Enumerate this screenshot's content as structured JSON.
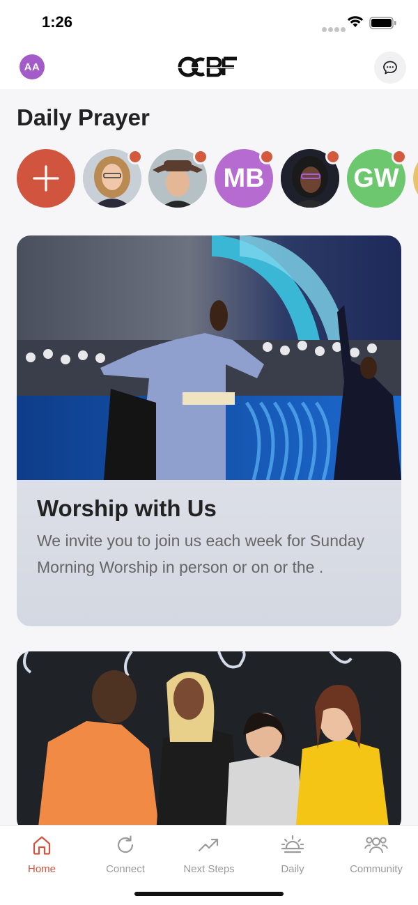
{
  "status_bar": {
    "time": "1:26"
  },
  "header": {
    "user_initials": "AA",
    "logo_text": "OCBF",
    "chat_icon": "chat-bubble-icon"
  },
  "daily_prayer": {
    "title": "Daily Prayer",
    "stories": [
      {
        "type": "add",
        "icon": "plus-icon"
      },
      {
        "type": "photo",
        "has_new": true
      },
      {
        "type": "photo",
        "has_new": true
      },
      {
        "type": "initials",
        "initials": "MB",
        "color": "#b66bd0",
        "has_new": true
      },
      {
        "type": "photo",
        "has_new": true
      },
      {
        "type": "initials",
        "initials": "GW",
        "color": "#6cc76f",
        "has_new": true
      }
    ]
  },
  "cards": [
    {
      "title": "Worship with Us",
      "description": "We invite you to join us each week for Sunday Morning Worship in person or on or the ."
    },
    {
      "title": "",
      "description": ""
    }
  ],
  "bottom_nav": {
    "items": [
      {
        "label": "Home",
        "icon": "home-icon",
        "active": true
      },
      {
        "label": "Connect",
        "icon": "refresh-icon",
        "active": false
      },
      {
        "label": "Next Steps",
        "icon": "trending-up-icon",
        "active": false
      },
      {
        "label": "Daily",
        "icon": "sunrise-icon",
        "active": false
      },
      {
        "label": "Community",
        "icon": "people-icon",
        "active": false
      }
    ]
  },
  "colors": {
    "accent": "#d1553e",
    "user_avatar": "#a35bc9",
    "inactive_nav": "#9a9a9a"
  }
}
